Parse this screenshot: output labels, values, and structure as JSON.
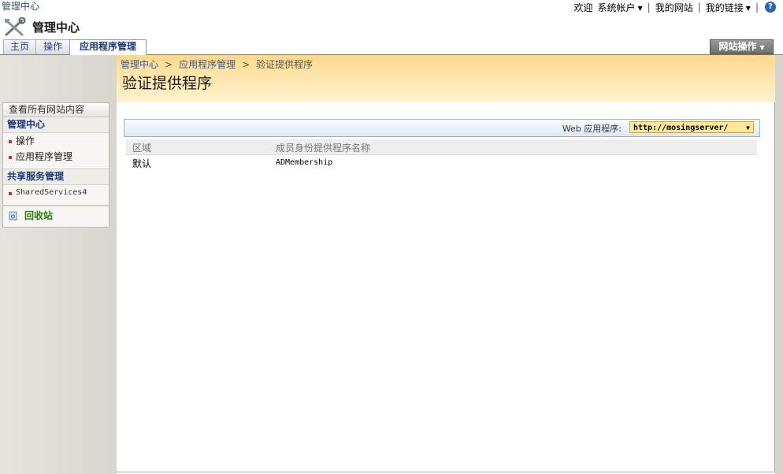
{
  "topbar": {
    "site_name": "管理中心",
    "welcome": "欢迎",
    "user": "系统帐户",
    "my_site": "我的网站",
    "my_links": "我的链接",
    "help_glyph": "?"
  },
  "header": {
    "title": "管理中心",
    "icon": "tools-icon"
  },
  "tabs": [
    {
      "label": "主页",
      "active": false
    },
    {
      "label": "操作",
      "active": false
    },
    {
      "label": "应用程序管理",
      "active": true
    }
  ],
  "site_actions": "网站操作",
  "quicklaunch": {
    "view_all": "查看所有网站内容",
    "sections": [
      {
        "heading": "管理中心",
        "items": [
          "操作",
          "应用程序管理"
        ]
      },
      {
        "heading": "共享服务管理",
        "items": [
          "SharedServices4"
        ]
      }
    ],
    "recycle_bin": "回收站"
  },
  "breadcrumb": [
    "管理中心",
    "应用程序管理",
    "验证提供程序"
  ],
  "page_title": "验证提供程序",
  "toolbar": {
    "web_app_label": "Web 应用程序:",
    "web_app_value": "http://mosingserver/"
  },
  "table": {
    "columns": [
      "区域",
      "成员身份提供程序名称"
    ],
    "rows": [
      [
        "默认",
        "ADMembership"
      ]
    ]
  },
  "colors": {
    "accent_blue": "#1b3a7a",
    "header_band": "#ffd98a",
    "recycle_green": "#2b7a0b"
  }
}
